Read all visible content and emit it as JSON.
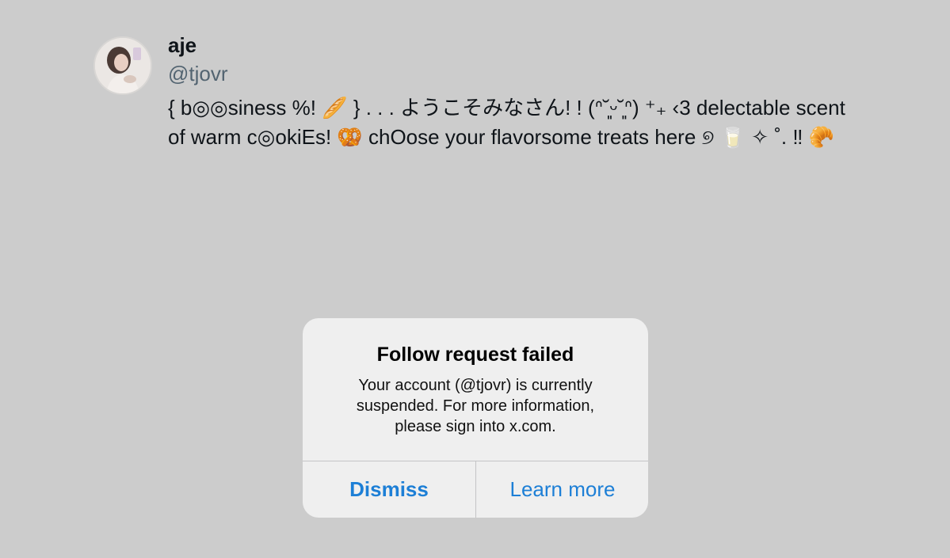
{
  "profile": {
    "name": "aje",
    "handle": "@tjovr",
    "bio_line1": "{ b◎◎siness %! 🥖 } . . . ようこそみなさん! ! (ᐢ˘͈ᵕ˘͈ᐢ) ⁺₊ ‹3 delectable scent",
    "bio_line2": "of warm c◎okiEs! 🥨 chOose your flavorsome treats here ୭ 🥛 ✧ ˚. ‼ 🥐"
  },
  "alert": {
    "title": "Follow request failed",
    "message_line1": "Your account (@tjovr) is currently",
    "message_line2": "suspended. For more information,",
    "message_line3": "please sign into x.com.",
    "dismiss_label": "Dismiss",
    "learn_more_label": "Learn more"
  },
  "colors": {
    "background": "#cccccc",
    "alert_background": "#efefef",
    "button_blue": "#1d7fd6",
    "handle_gray": "#536471"
  }
}
